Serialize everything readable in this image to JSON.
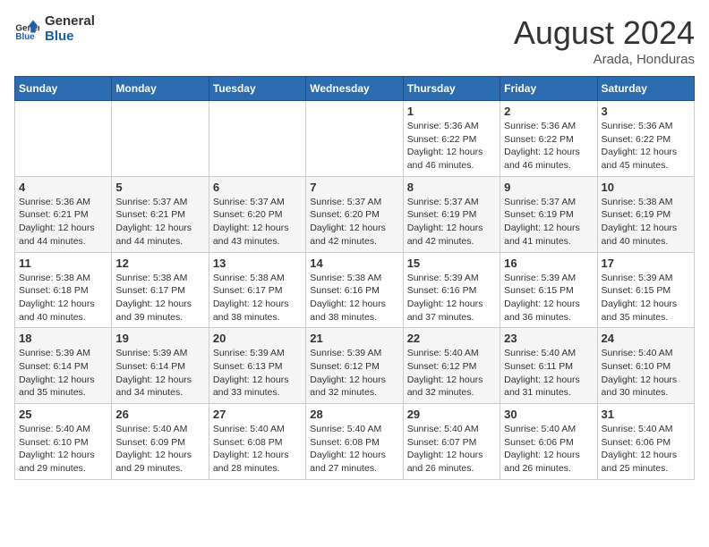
{
  "header": {
    "logo_general": "General",
    "logo_blue": "Blue",
    "month_title": "August 2024",
    "location": "Arada, Honduras"
  },
  "calendar": {
    "days_of_week": [
      "Sunday",
      "Monday",
      "Tuesday",
      "Wednesday",
      "Thursday",
      "Friday",
      "Saturday"
    ],
    "weeks": [
      [
        {
          "day": "",
          "info": ""
        },
        {
          "day": "",
          "info": ""
        },
        {
          "day": "",
          "info": ""
        },
        {
          "day": "",
          "info": ""
        },
        {
          "day": "1",
          "info": "Sunrise: 5:36 AM\nSunset: 6:22 PM\nDaylight: 12 hours\nand 46 minutes."
        },
        {
          "day": "2",
          "info": "Sunrise: 5:36 AM\nSunset: 6:22 PM\nDaylight: 12 hours\nand 46 minutes."
        },
        {
          "day": "3",
          "info": "Sunrise: 5:36 AM\nSunset: 6:22 PM\nDaylight: 12 hours\nand 45 minutes."
        }
      ],
      [
        {
          "day": "4",
          "info": "Sunrise: 5:36 AM\nSunset: 6:21 PM\nDaylight: 12 hours\nand 44 minutes."
        },
        {
          "day": "5",
          "info": "Sunrise: 5:37 AM\nSunset: 6:21 PM\nDaylight: 12 hours\nand 44 minutes."
        },
        {
          "day": "6",
          "info": "Sunrise: 5:37 AM\nSunset: 6:20 PM\nDaylight: 12 hours\nand 43 minutes."
        },
        {
          "day": "7",
          "info": "Sunrise: 5:37 AM\nSunset: 6:20 PM\nDaylight: 12 hours\nand 42 minutes."
        },
        {
          "day": "8",
          "info": "Sunrise: 5:37 AM\nSunset: 6:19 PM\nDaylight: 12 hours\nand 42 minutes."
        },
        {
          "day": "9",
          "info": "Sunrise: 5:37 AM\nSunset: 6:19 PM\nDaylight: 12 hours\nand 41 minutes."
        },
        {
          "day": "10",
          "info": "Sunrise: 5:38 AM\nSunset: 6:19 PM\nDaylight: 12 hours\nand 40 minutes."
        }
      ],
      [
        {
          "day": "11",
          "info": "Sunrise: 5:38 AM\nSunset: 6:18 PM\nDaylight: 12 hours\nand 40 minutes."
        },
        {
          "day": "12",
          "info": "Sunrise: 5:38 AM\nSunset: 6:17 PM\nDaylight: 12 hours\nand 39 minutes."
        },
        {
          "day": "13",
          "info": "Sunrise: 5:38 AM\nSunset: 6:17 PM\nDaylight: 12 hours\nand 38 minutes."
        },
        {
          "day": "14",
          "info": "Sunrise: 5:38 AM\nSunset: 6:16 PM\nDaylight: 12 hours\nand 38 minutes."
        },
        {
          "day": "15",
          "info": "Sunrise: 5:39 AM\nSunset: 6:16 PM\nDaylight: 12 hours\nand 37 minutes."
        },
        {
          "day": "16",
          "info": "Sunrise: 5:39 AM\nSunset: 6:15 PM\nDaylight: 12 hours\nand 36 minutes."
        },
        {
          "day": "17",
          "info": "Sunrise: 5:39 AM\nSunset: 6:15 PM\nDaylight: 12 hours\nand 35 minutes."
        }
      ],
      [
        {
          "day": "18",
          "info": "Sunrise: 5:39 AM\nSunset: 6:14 PM\nDaylight: 12 hours\nand 35 minutes."
        },
        {
          "day": "19",
          "info": "Sunrise: 5:39 AM\nSunset: 6:14 PM\nDaylight: 12 hours\nand 34 minutes."
        },
        {
          "day": "20",
          "info": "Sunrise: 5:39 AM\nSunset: 6:13 PM\nDaylight: 12 hours\nand 33 minutes."
        },
        {
          "day": "21",
          "info": "Sunrise: 5:39 AM\nSunset: 6:12 PM\nDaylight: 12 hours\nand 32 minutes."
        },
        {
          "day": "22",
          "info": "Sunrise: 5:40 AM\nSunset: 6:12 PM\nDaylight: 12 hours\nand 32 minutes."
        },
        {
          "day": "23",
          "info": "Sunrise: 5:40 AM\nSunset: 6:11 PM\nDaylight: 12 hours\nand 31 minutes."
        },
        {
          "day": "24",
          "info": "Sunrise: 5:40 AM\nSunset: 6:10 PM\nDaylight: 12 hours\nand 30 minutes."
        }
      ],
      [
        {
          "day": "25",
          "info": "Sunrise: 5:40 AM\nSunset: 6:10 PM\nDaylight: 12 hours\nand 29 minutes."
        },
        {
          "day": "26",
          "info": "Sunrise: 5:40 AM\nSunset: 6:09 PM\nDaylight: 12 hours\nand 29 minutes."
        },
        {
          "day": "27",
          "info": "Sunrise: 5:40 AM\nSunset: 6:08 PM\nDaylight: 12 hours\nand 28 minutes."
        },
        {
          "day": "28",
          "info": "Sunrise: 5:40 AM\nSunset: 6:08 PM\nDaylight: 12 hours\nand 27 minutes."
        },
        {
          "day": "29",
          "info": "Sunrise: 5:40 AM\nSunset: 6:07 PM\nDaylight: 12 hours\nand 26 minutes."
        },
        {
          "day": "30",
          "info": "Sunrise: 5:40 AM\nSunset: 6:06 PM\nDaylight: 12 hours\nand 26 minutes."
        },
        {
          "day": "31",
          "info": "Sunrise: 5:40 AM\nSunset: 6:06 PM\nDaylight: 12 hours\nand 25 minutes."
        }
      ]
    ]
  }
}
